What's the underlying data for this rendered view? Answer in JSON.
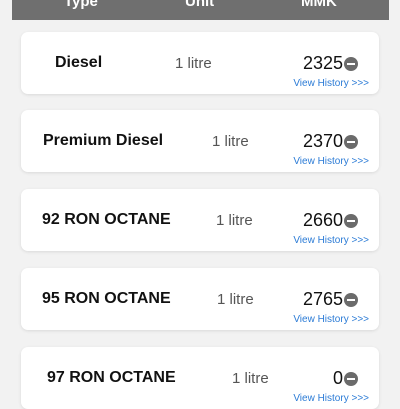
{
  "header": {
    "type_label": "Type",
    "unit_label": "Unit",
    "price_label": "MMK"
  },
  "fuels": [
    {
      "name": "Diesel",
      "unit": "1 litre",
      "price": "2325",
      "history": "View History >>>"
    },
    {
      "name": "Premium Diesel",
      "unit": "1 litre",
      "price": "2370",
      "history": "View History >>>"
    },
    {
      "name": "92 RON OCTANE",
      "unit": "1 litre",
      "price": "2660",
      "history": "View History >>>"
    },
    {
      "name": "95 RON OCTANE",
      "unit": "1 litre",
      "price": "2765",
      "history": "View History >>>"
    },
    {
      "name": "97 RON OCTANE",
      "unit": "1 litre",
      "price": "0",
      "history": "View History >>>"
    }
  ],
  "colors": {
    "header_bg": "#6f6f6f",
    "link": "#2b7bd6",
    "card_bg": "#ffffff",
    "page_bg": "#f2f2f2"
  }
}
